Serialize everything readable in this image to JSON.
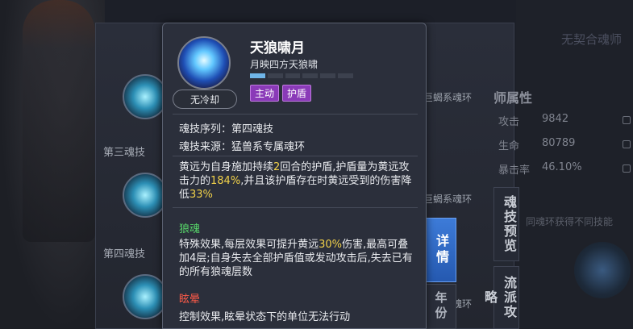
{
  "background": {
    "top_right": "无契合魂师",
    "attr_title": "师属性",
    "attributes": [
      {
        "label": "攻击",
        "value": "9842"
      },
      {
        "label": "生命",
        "value": "80789"
      },
      {
        "label": "暴击率",
        "value": "46.10%"
      }
    ],
    "ring_labels": [
      "巨蝎系魂环",
      "巨蝎系魂环",
      "巨蝎系魂环"
    ],
    "diff_skill_text": "同魂环获得不同技能",
    "slots": [
      "第三魂技",
      "第四魂技"
    ],
    "side_tabs": [
      "魂技预览",
      "流派攻略"
    ],
    "detail_tab": "详情",
    "year_tab": "年份"
  },
  "tooltip": {
    "name": "天狼啸月",
    "subtitle": "月映四方天狼啸",
    "badge": "无冷却",
    "tags": [
      "主动",
      "护盾"
    ],
    "progress_segments": 6,
    "progress_filled": 1,
    "sequence": "魂技序列：第四魂技",
    "source": "魂技来源：猛兽系专属魂环",
    "desc": [
      {
        "t": "黄远为自身施加持续",
        "h": false
      },
      {
        "t": "2",
        "h": true
      },
      {
        "t": "回合的护盾,护盾量为黄远攻击力的",
        "h": false
      },
      {
        "t": "184%",
        "h": true
      },
      {
        "t": ",并且该护盾存在时黄远受到的伤害降低",
        "h": false
      },
      {
        "t": "33%",
        "h": true
      }
    ],
    "sec1_title": "狼魂",
    "sec1_desc": [
      {
        "t": "特殊效果,每层效果可提升黄远",
        "h": false
      },
      {
        "t": "30%",
        "h": true
      },
      {
        "t": "伤害,最高可叠加4层;自身失去全部护盾值或发动攻击后,失去已有的所有狼魂层数",
        "h": false
      }
    ],
    "sec2_title": "眩晕",
    "sec2_desc": "控制效果,眩晕状态下的单位无法行动"
  },
  "colors": {
    "highlight": "#f2d24a",
    "green": "#57d66a",
    "red": "#ff5a48",
    "tag_bg": "#8a3ab8",
    "detail_tab": "#3d7bd8"
  }
}
